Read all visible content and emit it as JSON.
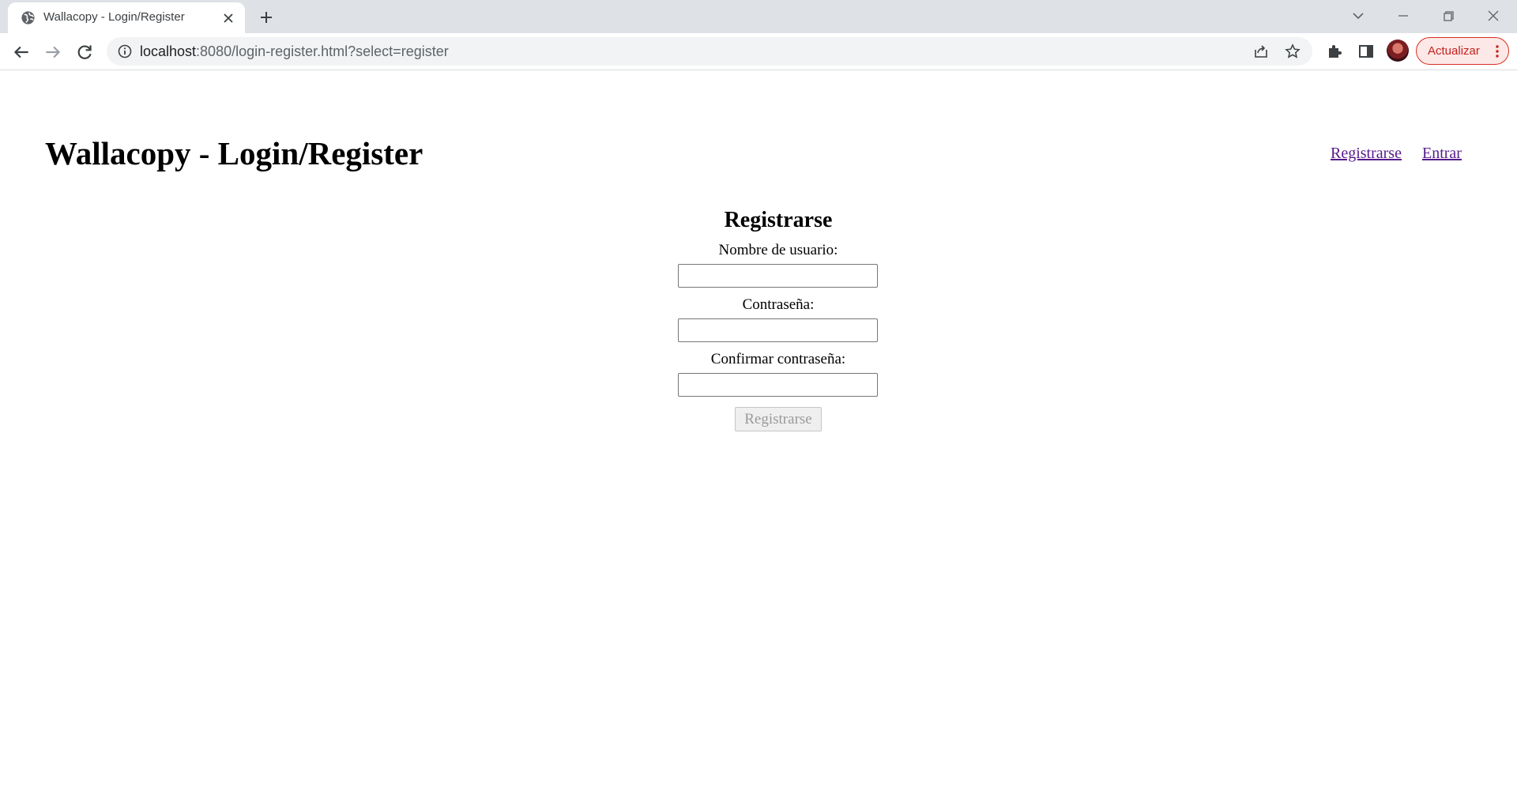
{
  "browser": {
    "tab_title": "Wallacopy - Login/Register",
    "url_host": "localhost",
    "url_rest": ":8080/login-register.html?select=register",
    "update_label": "Actualizar"
  },
  "header": {
    "title": "Wallacopy - Login/Register",
    "links": {
      "register": "Registrarse",
      "login": "Entrar"
    }
  },
  "form": {
    "heading": "Registrarse",
    "username_label": "Nombre de usuario:",
    "username_value": "",
    "password_label": "Contraseña:",
    "password_value": "",
    "confirm_label": "Confirmar contraseña:",
    "confirm_value": "",
    "submit_label": "Registrarse",
    "submit_disabled": true
  },
  "colors": {
    "link": "#1a0dab",
    "visited_link": "#551a8b",
    "update_accent": "#d93025"
  },
  "icons": [
    "globe-icon",
    "close-icon",
    "plus-icon",
    "chevron-down-icon",
    "minimize-icon",
    "restore-icon",
    "window-close-icon",
    "back-arrow-icon",
    "forward-arrow-icon",
    "reload-icon",
    "info-icon",
    "share-icon",
    "star-icon",
    "puzzle-icon",
    "side-panel-icon",
    "more-vert-icon"
  ]
}
